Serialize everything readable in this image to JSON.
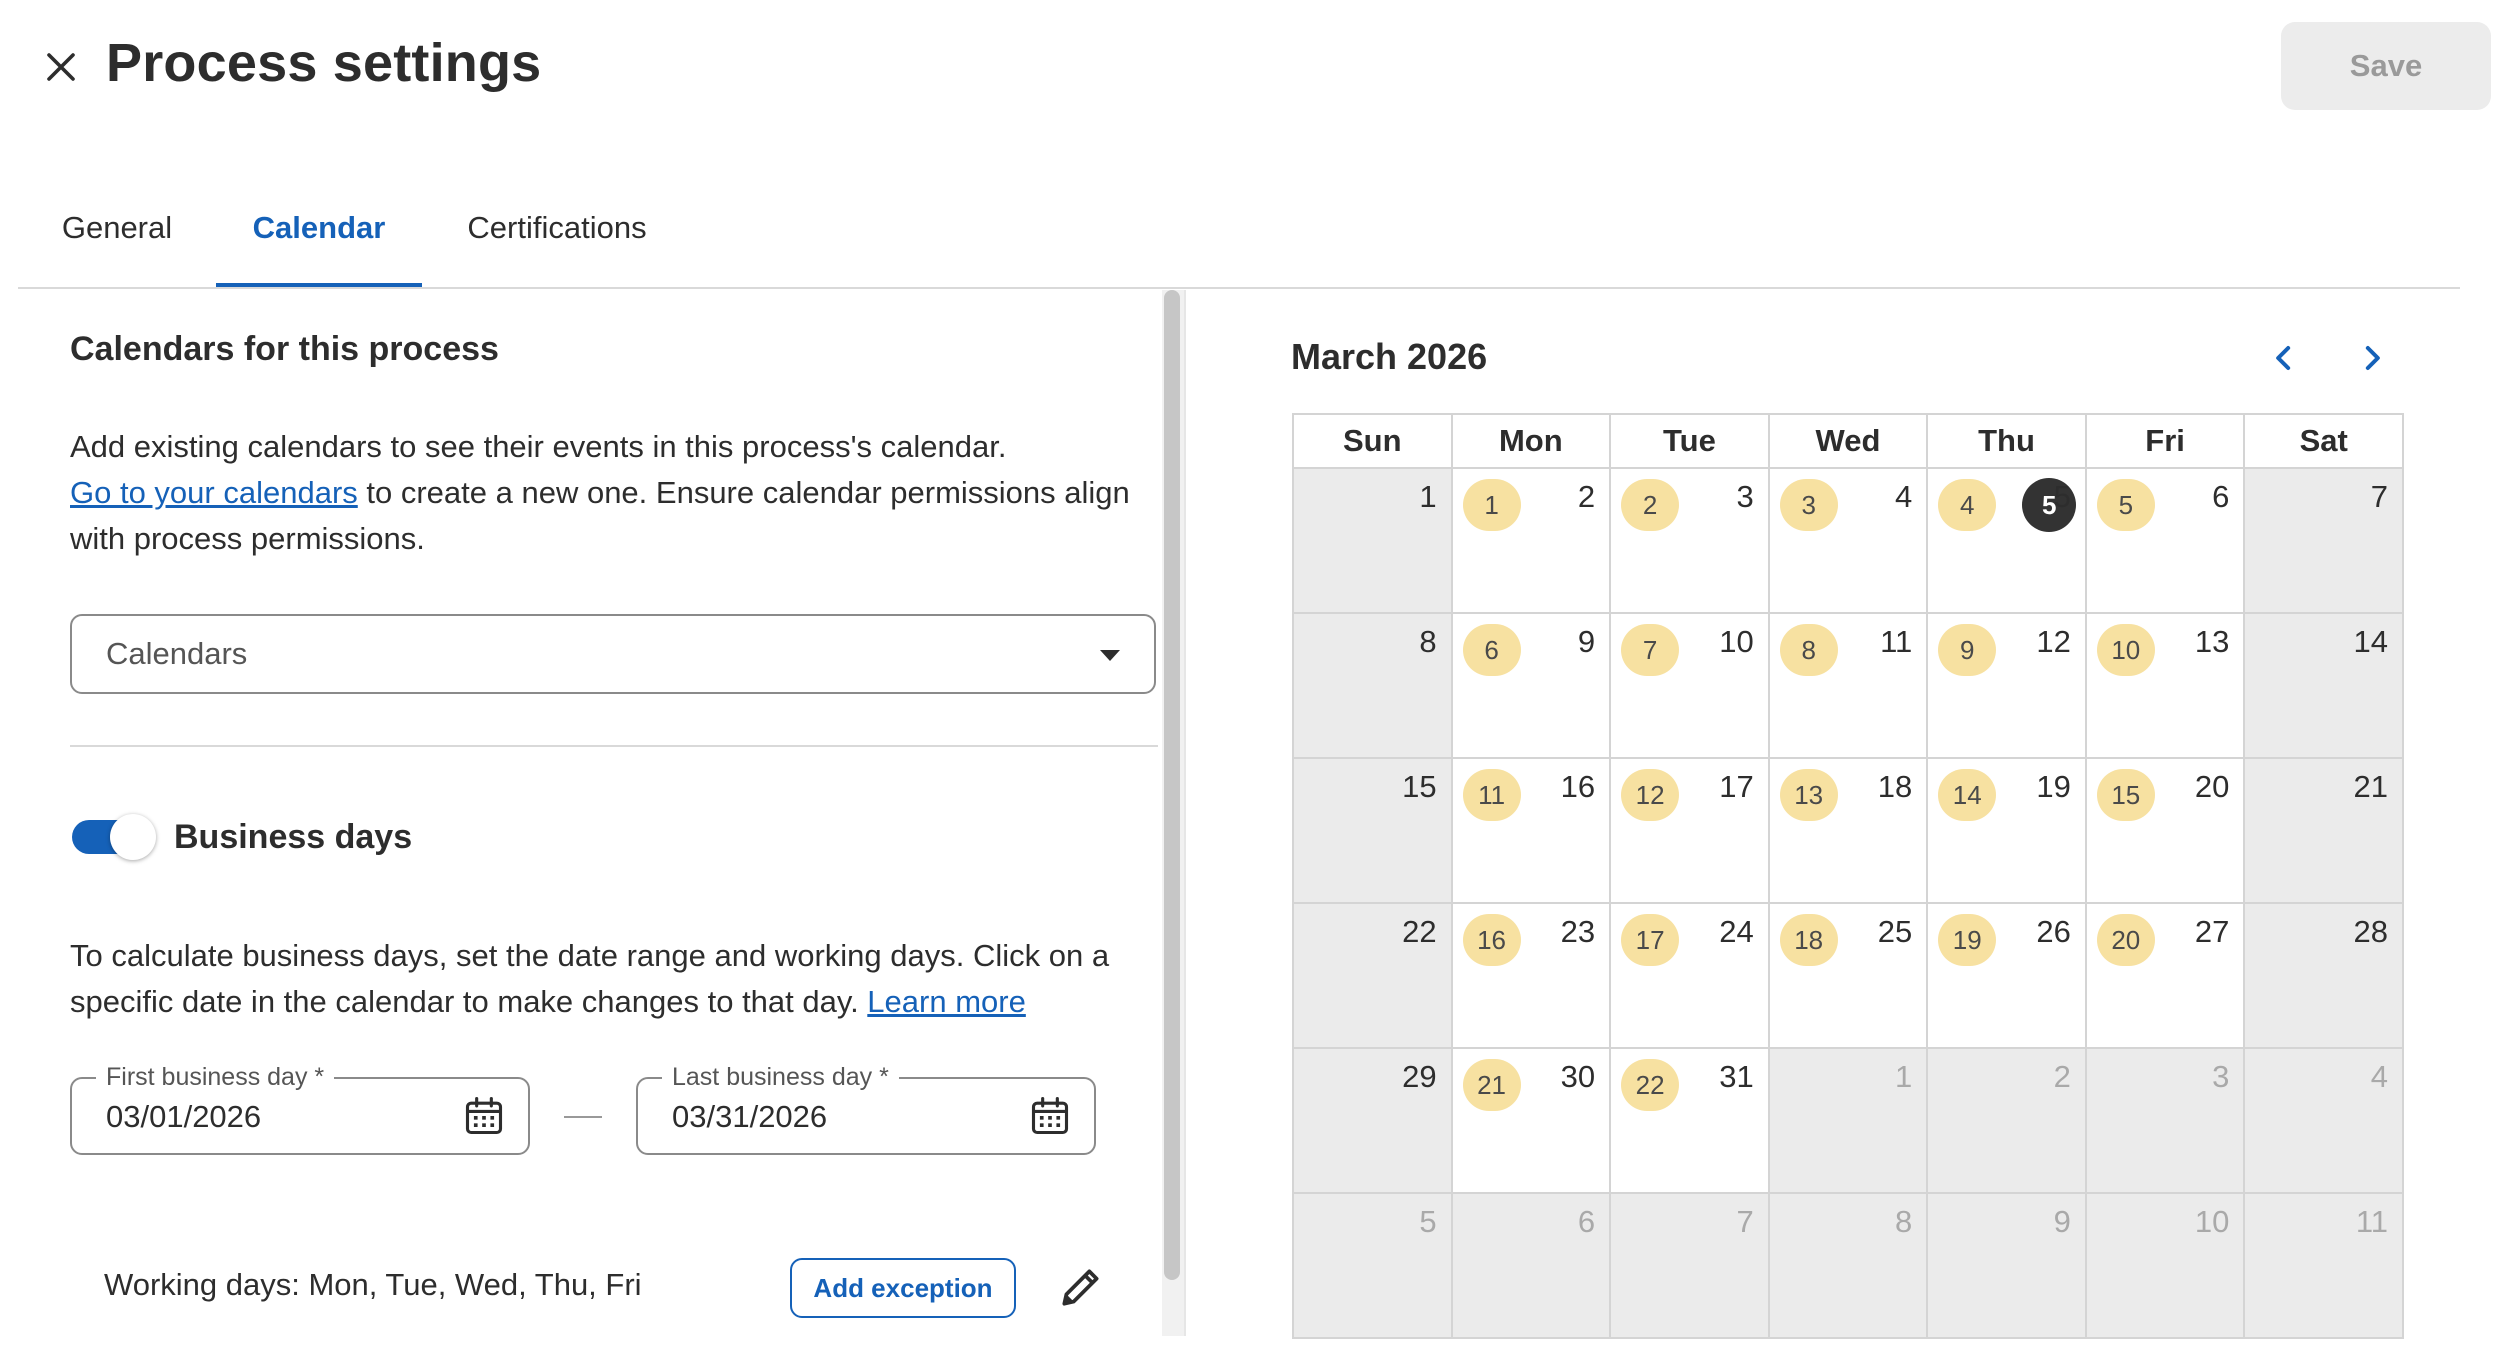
{
  "header": {
    "title": "Process settings",
    "save_label": "Save",
    "close_icon": "close-icon"
  },
  "tabs": [
    {
      "label": "General",
      "active": false
    },
    {
      "label": "Calendar",
      "active": true
    },
    {
      "label": "Certifications",
      "active": false
    }
  ],
  "calendars_section": {
    "title": "Calendars for this process",
    "desc_before": "Add existing calendars to see their events in this process's calendar.",
    "link_text": "Go to your calendars",
    "desc_after": " to create a new one. Ensure calendar permissions align with process permissions.",
    "select_placeholder": "Calendars"
  },
  "business_days": {
    "toggle_on": true,
    "title": "Business days",
    "desc": "To calculate business days, set the date range and working days. Click on a specific date in the calendar to make changes to that day. ",
    "learn_more": "Learn more",
    "first_label": "First business day *",
    "first_value": "03/01/2026",
    "last_label": "Last business day *",
    "last_value": "03/31/2026",
    "working_days": "Working days: Mon, Tue, Wed, Thu, Fri",
    "add_exception": "Add exception"
  },
  "calendar": {
    "month_title": "March 2026",
    "weekdays": [
      "Sun",
      "Mon",
      "Tue",
      "Wed",
      "Thu",
      "Fri",
      "Sat"
    ],
    "weeks": [
      [
        {
          "day": "1",
          "weekend": true
        },
        {
          "day": "2",
          "count": "1"
        },
        {
          "day": "3",
          "count": "2"
        },
        {
          "day": "4",
          "count": "3"
        },
        {
          "day": "5",
          "count": "4",
          "today": "5"
        },
        {
          "day": "6",
          "count": "5"
        },
        {
          "day": "7",
          "weekend": true
        }
      ],
      [
        {
          "day": "8",
          "weekend": true
        },
        {
          "day": "9",
          "count": "6"
        },
        {
          "day": "10",
          "count": "7"
        },
        {
          "day": "11",
          "count": "8"
        },
        {
          "day": "12",
          "count": "9"
        },
        {
          "day": "13",
          "count": "10"
        },
        {
          "day": "14",
          "weekend": true
        }
      ],
      [
        {
          "day": "15",
          "weekend": true
        },
        {
          "day": "16",
          "count": "11"
        },
        {
          "day": "17",
          "count": "12"
        },
        {
          "day": "18",
          "count": "13"
        },
        {
          "day": "19",
          "count": "14"
        },
        {
          "day": "20",
          "count": "15"
        },
        {
          "day": "21",
          "weekend": true
        }
      ],
      [
        {
          "day": "22",
          "weekend": true
        },
        {
          "day": "23",
          "count": "16"
        },
        {
          "day": "24",
          "count": "17"
        },
        {
          "day": "25",
          "count": "18"
        },
        {
          "day": "26",
          "count": "19"
        },
        {
          "day": "27",
          "count": "20"
        },
        {
          "day": "28",
          "weekend": true
        }
      ],
      [
        {
          "day": "29",
          "weekend": true
        },
        {
          "day": "30",
          "count": "21"
        },
        {
          "day": "31",
          "count": "22"
        },
        {
          "day": "1",
          "other": true
        },
        {
          "day": "2",
          "other": true
        },
        {
          "day": "3",
          "other": true
        },
        {
          "day": "4",
          "other": true
        }
      ],
      [
        {
          "day": "5",
          "other": true
        },
        {
          "day": "6",
          "other": true
        },
        {
          "day": "7",
          "other": true
        },
        {
          "day": "8",
          "other": true
        },
        {
          "day": "9",
          "other": true
        },
        {
          "day": "10",
          "other": true
        },
        {
          "day": "11",
          "other": true
        }
      ]
    ]
  },
  "colors": {
    "accent": "#1561b8",
    "business_pill": "#f7e1a1",
    "today": "#333333",
    "weekend_bg": "#ebebeb"
  }
}
